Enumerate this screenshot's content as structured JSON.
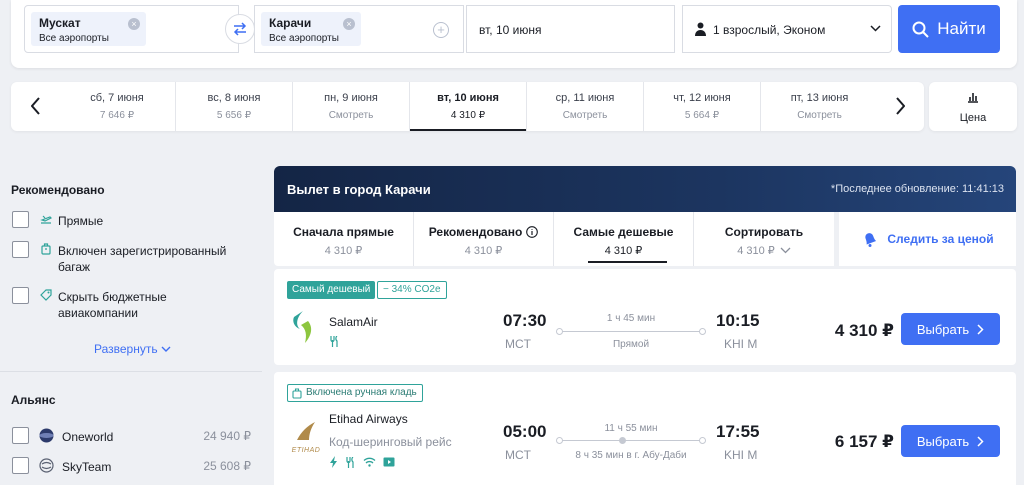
{
  "search": {
    "origin": {
      "city": "Мускат",
      "sub": "Все аэропорты"
    },
    "destination": {
      "city": "Карачи",
      "sub": "Все аэропорты"
    },
    "date": "вт, 10 июня",
    "passengers": "1 взрослый, Эконом",
    "find_label": "Найти"
  },
  "dates": [
    {
      "day": "сб, 7 июня",
      "price": "7 646 ₽"
    },
    {
      "day": "вс, 8 июня",
      "price": "5 656 ₽"
    },
    {
      "day": "пн, 9 июня",
      "price": "Смотреть"
    },
    {
      "day": "вт, 10 июня",
      "price": "4 310 ₽",
      "selected": true
    },
    {
      "day": "ср, 11 июня",
      "price": "Смотреть"
    },
    {
      "day": "чт, 12 июня",
      "price": "5 664 ₽"
    },
    {
      "day": "пт, 13 июня",
      "price": "Смотреть"
    }
  ],
  "price_tab": "Цена",
  "filters": {
    "recommended_title": "Рекомендовано",
    "recommended": [
      {
        "label": "Прямые",
        "icon": "plane-icon"
      },
      {
        "label": "Включен зарегистрированный багаж",
        "icon": "suitcase-icon"
      },
      {
        "label": "Скрыть бюджетные авиакомпании",
        "icon": "tag-icon"
      }
    ],
    "expand_label": "Развернуть",
    "alliance_title": "Альянс",
    "alliances": [
      {
        "label": "Oneworld",
        "price": "24 940 ₽"
      },
      {
        "label": "SkyTeam",
        "price": "25 608 ₽"
      }
    ]
  },
  "results": {
    "title": "Вылет в город Карачи",
    "updated": "*Последнее обновление: 11:41:13",
    "sort": [
      {
        "label": "Сначала прямые",
        "price": "4 310 ₽"
      },
      {
        "label": "Рекомендовано",
        "price": "4 310 ₽",
        "info": true
      },
      {
        "label": "Самые дешевые",
        "price": "4 310 ₽",
        "selected": true
      },
      {
        "label": "Сортировать",
        "price": "4 310 ₽",
        "dropdown": true
      }
    ],
    "track_label": "Следить за ценой",
    "flights": [
      {
        "badges": [
          "Самый дешевый",
          "− 34% CO2e"
        ],
        "airline": "SalamAir",
        "dep_time": "07:30",
        "dep_code": "MCT",
        "arr_time": "10:15",
        "arr_code": "KHI M",
        "duration": "1 ч 45 мин",
        "stops": "Прямой",
        "price": "4 310 ₽",
        "choose_label": "Выбрать"
      },
      {
        "badges": [
          "Включена ручная кладь"
        ],
        "airline": "Etihad Airways",
        "codeshare": "Код-шеринговый рейс",
        "logo_text": "ETIHAD",
        "dep_time": "05:00",
        "dep_code": "MCT",
        "arr_time": "17:55",
        "arr_code": "KHI M",
        "duration": "11 ч 55 мин",
        "stops": "8 ч 35 мин в г. Абу-Даби",
        "price": "6 157 ₽",
        "choose_label": "Выбрать"
      }
    ]
  },
  "colors": {
    "accent": "#3f6ff3",
    "header_bg": "#142545",
    "teal": "#2fa39a"
  }
}
